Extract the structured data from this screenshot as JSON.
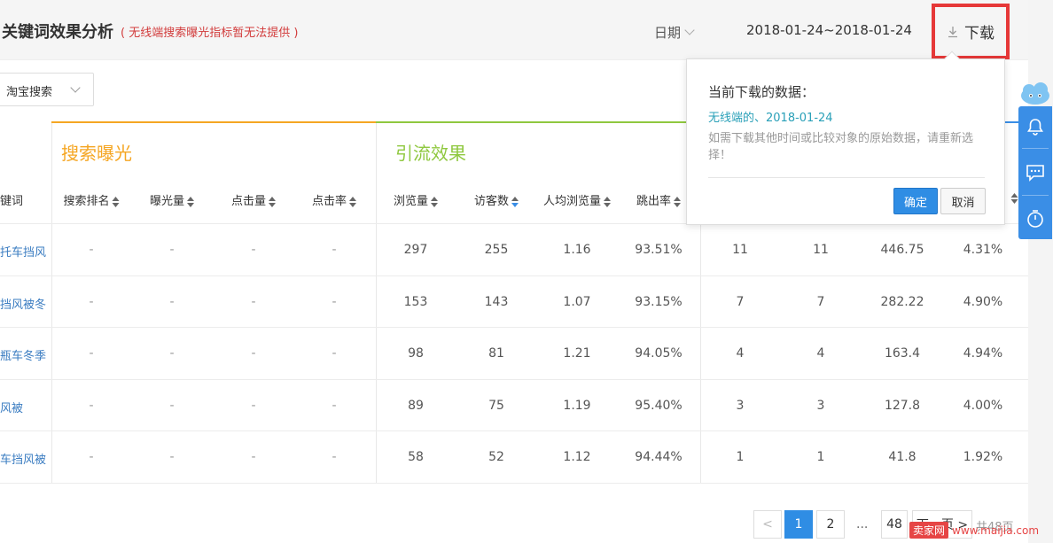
{
  "header": {
    "title": "关键词效果分析",
    "subtitle": "( 无线端搜索曝光指标暂无法提供 )",
    "date_label": "日期",
    "date_range": "2018-01-24~2018-01-24",
    "download_label": "下载"
  },
  "filter": {
    "source_select": "淘宝搜索"
  },
  "groups": {
    "search_exposure": "搜索曝光",
    "traffic_effect": "引流效果"
  },
  "columns": {
    "keyword": "键词",
    "search_rank": "搜索排名",
    "exposure": "曝光量",
    "clicks": "点击量",
    "ctr": "点击率",
    "pageviews": "浏览量",
    "visitors": "访客数",
    "avg_pv": "人均浏览量",
    "bounce": "跳出率"
  },
  "rows": [
    {
      "keyword": "托车挡风",
      "rank": "-",
      "exposure": "-",
      "clicks": "-",
      "ctr": "-",
      "pv": "297",
      "uv": "255",
      "avg": "1.16",
      "bounce": "93.51%",
      "c1": "11",
      "c2": "11",
      "c3": "446.75",
      "c4": "4.31%"
    },
    {
      "keyword": "挡风被冬",
      "rank": "-",
      "exposure": "-",
      "clicks": "-",
      "ctr": "-",
      "pv": "153",
      "uv": "143",
      "avg": "1.07",
      "bounce": "93.15%",
      "c1": "7",
      "c2": "7",
      "c3": "282.22",
      "c4": "4.90%"
    },
    {
      "keyword": "瓶车冬季",
      "rank": "-",
      "exposure": "-",
      "clicks": "-",
      "ctr": "-",
      "pv": "98",
      "uv": "81",
      "avg": "1.21",
      "bounce": "94.05%",
      "c1": "4",
      "c2": "4",
      "c3": "163.4",
      "c4": "4.94%"
    },
    {
      "keyword": "风被",
      "rank": "-",
      "exposure": "-",
      "clicks": "-",
      "ctr": "-",
      "pv": "89",
      "uv": "75",
      "avg": "1.19",
      "bounce": "95.40%",
      "c1": "3",
      "c2": "3",
      "c3": "127.8",
      "c4": "4.00%"
    },
    {
      "keyword": "车挡风被",
      "rank": "-",
      "exposure": "-",
      "clicks": "-",
      "ctr": "-",
      "pv": "58",
      "uv": "52",
      "avg": "1.12",
      "bounce": "94.44%",
      "c1": "1",
      "c2": "1",
      "c3": "41.8",
      "c4": "1.92%"
    }
  ],
  "popup": {
    "heading": "当前下载的数据：",
    "selection": "无线端的、2018-01-24",
    "note": "如需下载其他时间或比较对象的原始数据，请重新选择！",
    "ok_label": "确定",
    "cancel_label": "取消"
  },
  "pagination": {
    "prev": "<",
    "page1": "1",
    "page2": "2",
    "ellipsis": "...",
    "last": "48",
    "next": "下一页 >",
    "total": "共48页"
  },
  "watermark": {
    "badge": "卖家网",
    "url": "www.maijia.com"
  },
  "colors": {
    "orange": "#f5a623",
    "green": "#8fc83f",
    "blue": "#2f8de4",
    "red_highlight": "#e63838"
  },
  "icons": [
    "download-icon",
    "chevron-down-icon",
    "cloud-mascot-icon",
    "bell-icon",
    "chat-icon",
    "timer-icon",
    "sort-icon"
  ]
}
